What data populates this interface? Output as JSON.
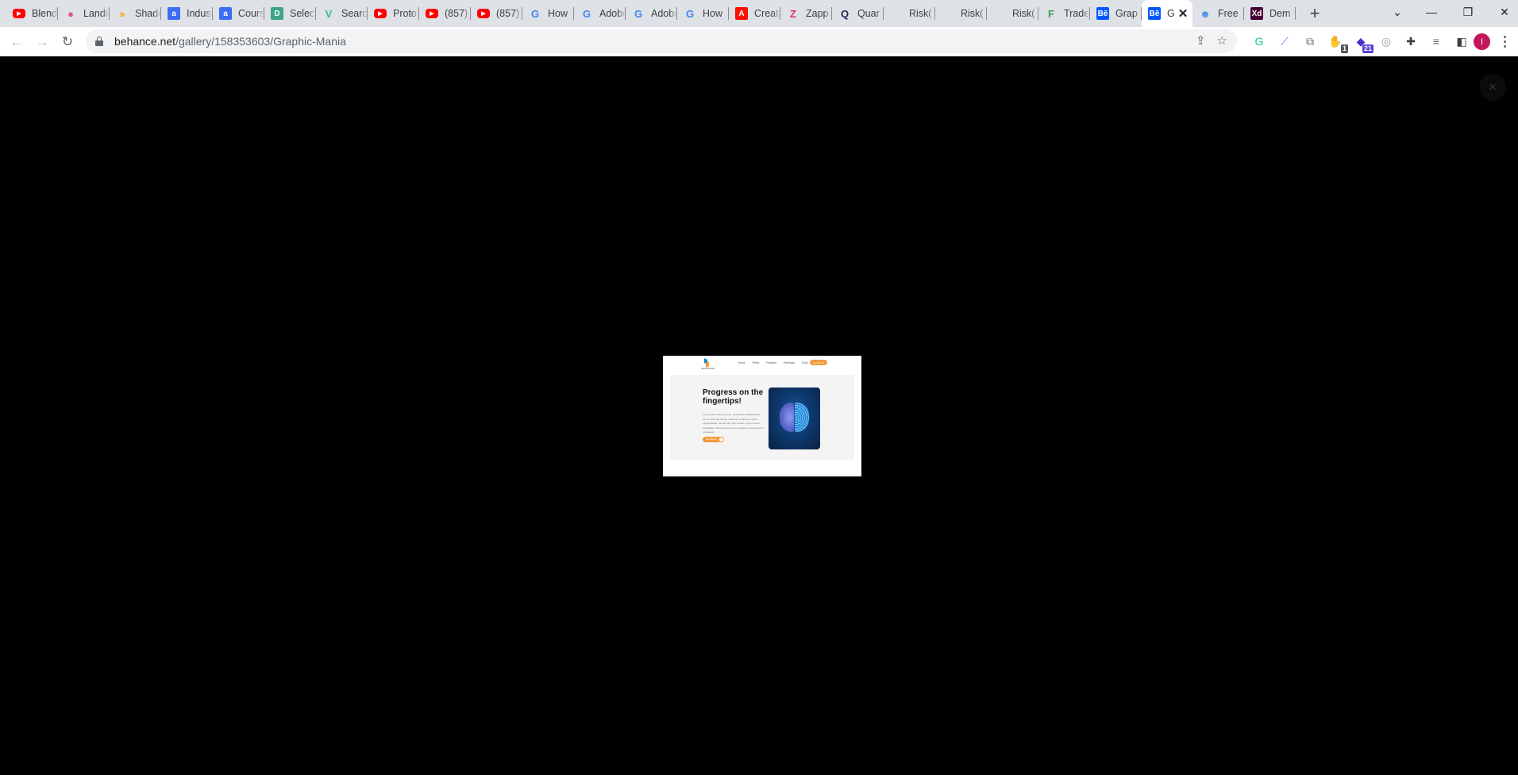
{
  "browser": {
    "tabs": [
      {
        "label": "Blender",
        "favicon": "youtube-icon",
        "color": "#ff0000"
      },
      {
        "label": "Landing",
        "favicon": "dribbble-icon",
        "color": "#ea4c89"
      },
      {
        "label": "Shadow",
        "favicon": "chevrons-icon",
        "color": "#f4a400"
      },
      {
        "label": "Industry",
        "favicon": "a-icon",
        "color": "#3b6cf6"
      },
      {
        "label": "Course",
        "favicon": "a-icon",
        "color": "#3b6cf6"
      },
      {
        "label": "Select",
        "favicon": "d-icon",
        "color": "#3da58a"
      },
      {
        "label": "Search",
        "favicon": "v-icon",
        "color": "#2ec27e"
      },
      {
        "label": "Proto",
        "favicon": "youtube-icon",
        "color": "#ff0000"
      },
      {
        "label": "(857)",
        "favicon": "youtube-icon",
        "color": "#ff0000"
      },
      {
        "label": "(857)",
        "favicon": "youtube-icon",
        "color": "#ff0000"
      },
      {
        "label": "How",
        "favicon": "google-icon",
        "color": "#4285f4"
      },
      {
        "label": "Adobe",
        "favicon": "google-icon",
        "color": "#4285f4"
      },
      {
        "label": "Adobe",
        "favicon": "google-icon",
        "color": "#4285f4"
      },
      {
        "label": "How",
        "favicon": "google-icon",
        "color": "#4285f4"
      },
      {
        "label": "Create",
        "favicon": "adobe-icon",
        "color": "#fa0f00"
      },
      {
        "label": "Zapp",
        "favicon": "zapp-icon",
        "color": "#e0287a"
      },
      {
        "label": "Quar",
        "favicon": "quar-icon",
        "color": "#1a2a4a"
      },
      {
        "label": "Risk(",
        "favicon": "",
        "color": ""
      },
      {
        "label": "Risk(",
        "favicon": "",
        "color": ""
      },
      {
        "label": "Risk(",
        "favicon": "",
        "color": ""
      },
      {
        "label": "Trade",
        "favicon": "f-icon",
        "color": "#3aa14a"
      },
      {
        "label": "Grap",
        "favicon": "behance-icon",
        "color": "#0057ff"
      },
      {
        "label": "G",
        "favicon": "behance-icon",
        "color": "#0057ff",
        "active": true
      },
      {
        "label": "Free",
        "favicon": "robot-icon",
        "color": "#4a90e2"
      },
      {
        "label": "Dem",
        "favicon": "xd-icon",
        "color": "#470137"
      }
    ],
    "favicon_glyphs": {
      "youtube-icon": "▶",
      "dribbble-icon": "●",
      "chevrons-icon": "»",
      "a-icon": "a",
      "d-icon": "D",
      "v-icon": "V",
      "google-icon": "G",
      "adobe-icon": "A",
      "zapp-icon": "Z",
      "quar-icon": "Q",
      "f-icon": "F",
      "behance-icon": "Bē",
      "robot-icon": "☻",
      "xd-icon": "Xd"
    },
    "new_tab_label": "+",
    "url": {
      "domain": "behance.net",
      "path": "/gallery/158353603/Graphic-Mania"
    },
    "extensions": [
      {
        "name": "grammarly-icon",
        "glyph": "G",
        "color": "#15c39a"
      },
      {
        "name": "feather-icon",
        "glyph": "⟋",
        "color": "#8b5cf6"
      },
      {
        "name": "screenshot-icon",
        "glyph": "⧉",
        "color": "#5f6368"
      },
      {
        "name": "adblock-icon",
        "glyph": "✋",
        "color": "#d01f1f",
        "badge": "1",
        "badge_color": "#555"
      },
      {
        "name": "grad-cap-icon",
        "glyph": "◆",
        "color": "#4b2fc9",
        "badge": "21",
        "badge_color": "#5b3ed6"
      },
      {
        "name": "camera-icon",
        "glyph": "◎",
        "color": "#9aa0a6"
      },
      {
        "name": "puzzle-icon",
        "glyph": "✚",
        "color": "#3c4043"
      },
      {
        "name": "media-icon",
        "glyph": "≡",
        "color": "#5f6368"
      },
      {
        "name": "sidepanel-icon",
        "glyph": "◧",
        "color": "#3c4043"
      }
    ],
    "profile_initial": "I"
  },
  "viewer": {
    "close_label": "×",
    "image": {
      "brand_text": "NEUROMIND",
      "nav": [
        "Home",
        "Pillars",
        "Features",
        "Feedback",
        "FAQs"
      ],
      "cta": "Contact Us",
      "headline": "Progress on the fingertips!",
      "body": "Lorem ipsum dolor sit amet, consectetur adipiscing elit, sed do eiusmod tempor incididunt ut labore et dolore magna aliqua. Ut enim ad minim veniam, quis nostrud exercitation ullamco laboris nisi ut aliquip ex ea commodo consequat.",
      "button": "Get Started"
    }
  }
}
